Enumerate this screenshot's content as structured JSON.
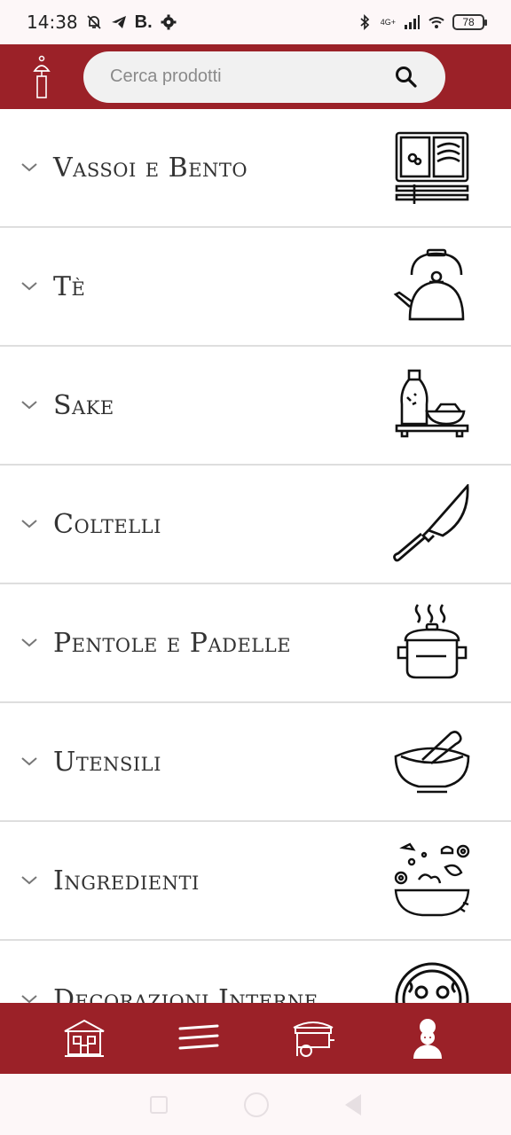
{
  "status_bar": {
    "time": "14:38",
    "carrier_badge": "B.",
    "network": "4G+",
    "battery": "78"
  },
  "header": {
    "search": {
      "placeholder": "Cerca prodotti"
    }
  },
  "categories": [
    {
      "label": "Vassoi e Bento",
      "icon": "bento-box-icon"
    },
    {
      "label": "Tè",
      "icon": "teapot-icon"
    },
    {
      "label": "Sake",
      "icon": "sake-set-icon"
    },
    {
      "label": "Coltelli",
      "icon": "knife-icon"
    },
    {
      "label": "Pentole e Padelle",
      "icon": "cooking-pot-icon"
    },
    {
      "label": "Utensili",
      "icon": "mortar-pestle-icon"
    },
    {
      "label": "Ingredienti",
      "icon": "ingredients-bowl-icon"
    },
    {
      "label": "Decorazioni Interne",
      "icon": "decorative-plate-icon"
    }
  ],
  "bottom_nav": [
    {
      "icon": "japanese-house-icon"
    },
    {
      "icon": "chopsticks-icon"
    },
    {
      "icon": "food-cart-icon"
    },
    {
      "icon": "geisha-profile-icon"
    }
  ],
  "colors": {
    "primary": "#9b2128",
    "text": "#333333",
    "divider": "#dedede"
  }
}
